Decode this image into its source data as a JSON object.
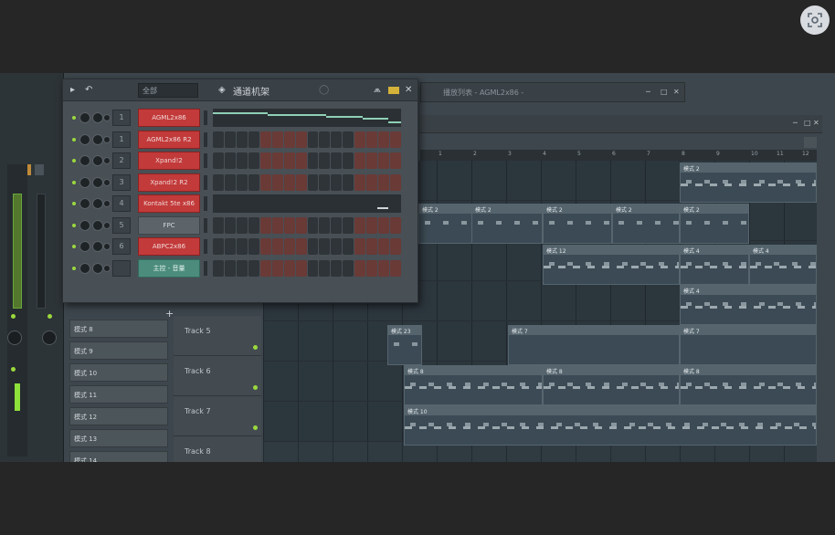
{
  "rack": {
    "title": "通道机架",
    "group_selector": "全部",
    "channels": [
      {
        "num": "1",
        "name": "AGML2x86",
        "style": "red",
        "content": "roll"
      },
      {
        "num": "1",
        "name": "AGML2x86 R2",
        "style": "red",
        "content": "steps"
      },
      {
        "num": "2",
        "name": "Xpand!2",
        "style": "red",
        "content": "steps"
      },
      {
        "num": "3",
        "name": "Xpand!2 R2",
        "style": "red",
        "content": "steps"
      },
      {
        "num": "4",
        "name": "Kontakt 5te x86",
        "style": "red",
        "content": "roll"
      },
      {
        "num": "5",
        "name": "FPC",
        "style": "gray",
        "content": "steps"
      },
      {
        "num": "6",
        "name": "ABPC2x86",
        "style": "red",
        "content": "steps"
      },
      {
        "num": "",
        "name": "主控 - 音量",
        "style": "teal",
        "content": "steps"
      }
    ]
  },
  "playlist": {
    "title": "播放列表 - AGML2x86 -",
    "timeline": [
      "1",
      "2",
      "3",
      "4",
      "5",
      "6",
      "7",
      "8",
      "9",
      "10",
      "11",
      "12"
    ],
    "tracks": [
      {
        "label": "Track 5"
      },
      {
        "label": "Track 6"
      },
      {
        "label": "Track 7"
      },
      {
        "label": "Track 8"
      }
    ],
    "patterns": [
      "模式 8",
      "模式 9",
      "模式 10",
      "模式 11",
      "模式 12",
      "模式 13",
      "模式 14"
    ],
    "clips": {
      "c1": "模式 2",
      "c2": "模式 2",
      "c3": "模式 2",
      "c4": "模式 2",
      "c5": "模式 2",
      "c6": "模式 2",
      "c7": "模式 12",
      "c8": "模式 4",
      "c9": "模式 4",
      "c10": "模式 4",
      "c11": "模式 23",
      "c12": "模式 7",
      "c13": "模式 7",
      "c14": "模式 8",
      "c15": "模式 8",
      "c16": "模式 8",
      "c17": "模式 10"
    }
  }
}
